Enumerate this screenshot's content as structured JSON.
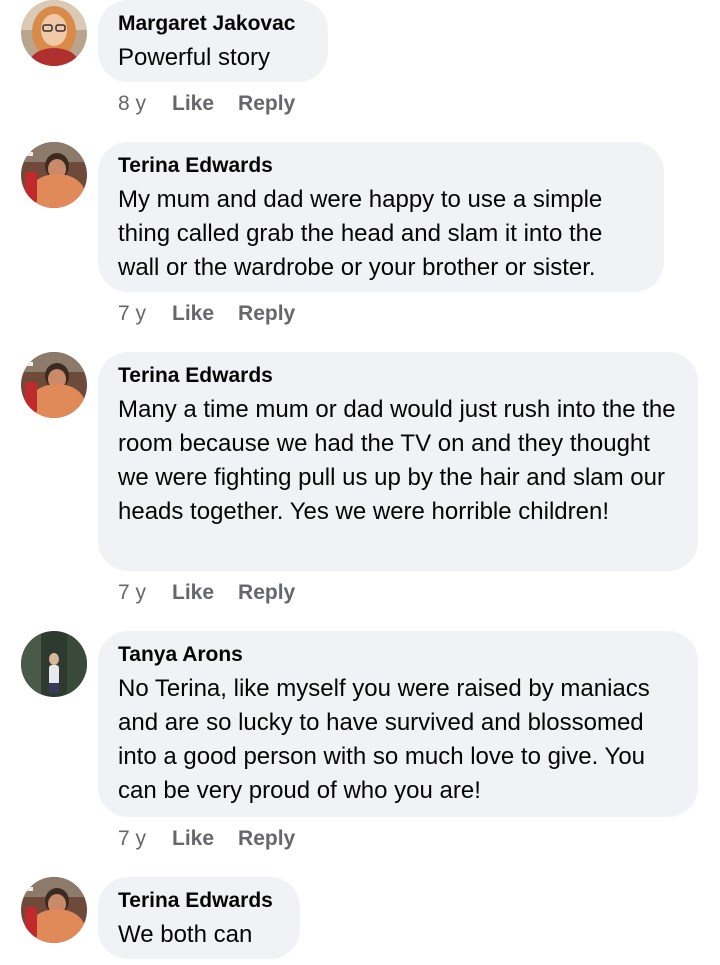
{
  "comments": [
    {
      "author": "Margaret Jakovac",
      "avatar_icon": "user-avatar-margaret",
      "text": "Powerful story",
      "age": "8 y",
      "like_label": "Like",
      "reply_label": "Reply"
    },
    {
      "author": "Terina Edwards",
      "avatar_icon": "user-avatar-terina",
      "text": "My mum and dad were happy to use a simple thing called grab the head and slam it into the wall or the wardrobe or your brother or sister.",
      "age": "7 y",
      "like_label": "Like",
      "reply_label": "Reply"
    },
    {
      "author": "Terina Edwards",
      "avatar_icon": "user-avatar-terina",
      "text": "Many a time mum or dad would just rush into the the room because we had the TV on and they thought we were fighting pull us up by the hair and slam our heads together. Yes we were horrible children!",
      "age": "7 y",
      "like_label": "Like",
      "reply_label": "Reply"
    },
    {
      "author": "Tanya Arons",
      "avatar_icon": "user-avatar-tanya",
      "text": "No Terina, like myself you were raised by maniacs and are so lucky to have survived and blossomed into a good person with so much love to give.  You can be very proud of who you are!",
      "age": "7 y",
      "like_label": "Like",
      "reply_label": "Reply"
    },
    {
      "author": "Terina Edwards",
      "avatar_icon": "user-avatar-terina",
      "text": "We both can",
      "age": null,
      "like_label": null,
      "reply_label": null
    }
  ],
  "colors": {
    "bubble": "#f0f2f5",
    "author_text": "#050505",
    "meta_text": "#65676b"
  }
}
